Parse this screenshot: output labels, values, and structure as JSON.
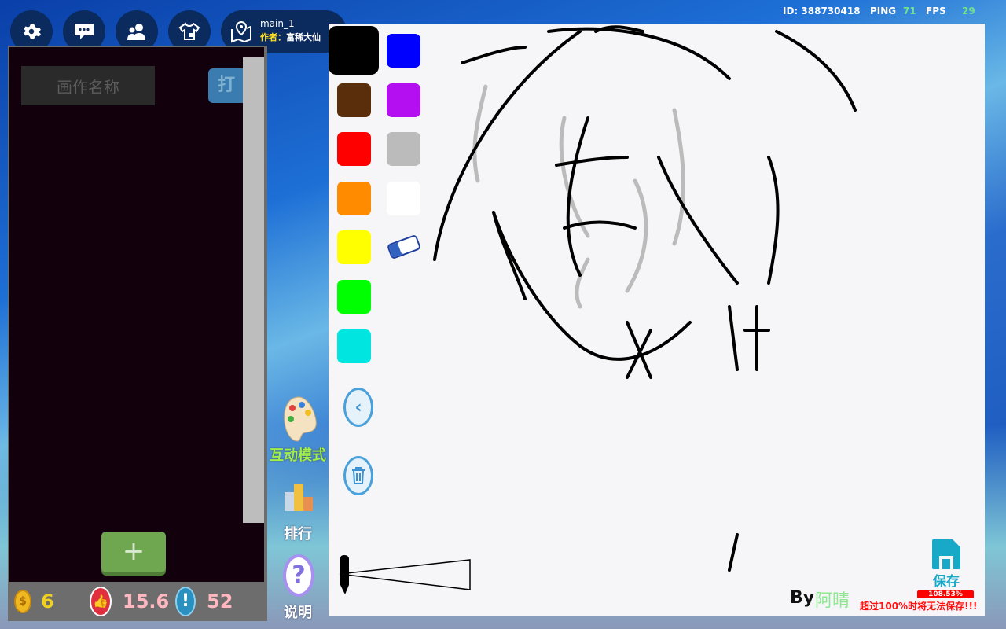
{
  "top_bar": {
    "icons": [
      "gear-icon",
      "chat-icon",
      "friends-icon",
      "outfit-icon",
      "map-pin-icon"
    ],
    "room": "main_1",
    "author_label": "作者：",
    "author": "富稀大仙",
    "id_label": "ID: 388730418",
    "ping_label": "PING",
    "ping": "71",
    "fps_label": "FPS",
    "fps": "29"
  },
  "left_panel": {
    "name_placeholder": "画作名称",
    "open_button": "打",
    "add_button": "+",
    "coins": "6",
    "likes": "15.6",
    "reports": "52"
  },
  "side": {
    "interactive_mode": "互动模式",
    "ranking": "排行",
    "help": "说明"
  },
  "palette": {
    "colors": [
      "#000000",
      "#0000ff",
      "#5a2e0a",
      "#b40ff0",
      "#ff0000",
      "#bbbbbb",
      "#ff8c00",
      "#ffffff",
      "#ffff00",
      "#00ff00",
      "#00e5e0"
    ],
    "eraser": "eraser-icon"
  },
  "canvas": {
    "signature_by": "By",
    "signature_name": "阿晴",
    "save_label": "保存",
    "usage_percent": "108.53%",
    "usage_value": 108.53,
    "warning": "超过100%时将无法保存!!!"
  }
}
